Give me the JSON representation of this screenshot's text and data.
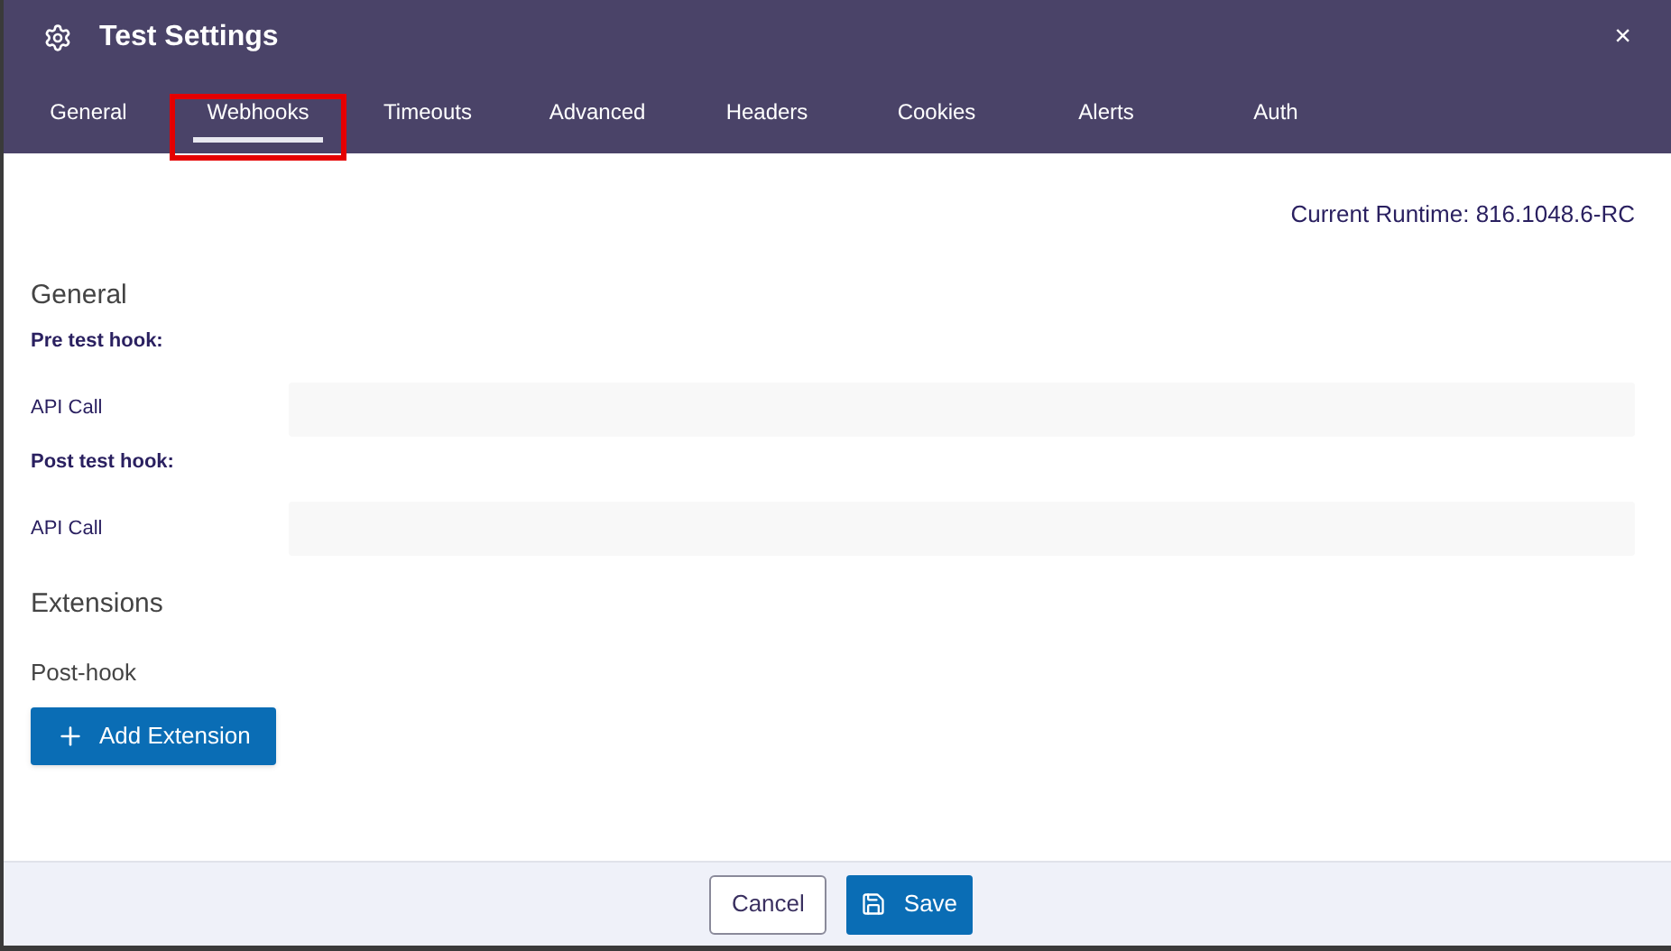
{
  "window": {
    "title": "Test Settings",
    "close": "×"
  },
  "tabs": [
    {
      "label": "General",
      "selected": false,
      "highlighted": false
    },
    {
      "label": "Webhooks",
      "selected": true,
      "highlighted": true
    },
    {
      "label": "Timeouts",
      "selected": false,
      "highlighted": false
    },
    {
      "label": "Advanced",
      "selected": false,
      "highlighted": false
    },
    {
      "label": "Headers",
      "selected": false,
      "highlighted": false
    },
    {
      "label": "Cookies",
      "selected": false,
      "highlighted": false
    },
    {
      "label": "Alerts",
      "selected": false,
      "highlighted": false
    },
    {
      "label": "Auth",
      "selected": false,
      "highlighted": false
    }
  ],
  "runtime": "Current Runtime: 816.1048.6-RC",
  "general": {
    "heading": "General",
    "hooks": [
      {
        "title": "Pre test hook:",
        "field_label": "API Call"
      },
      {
        "title": "Post test hook:",
        "field_label": "API Call"
      }
    ]
  },
  "extensions": {
    "heading": "Extensions",
    "subheading": "Post-hook",
    "button": "Add Extension"
  },
  "footer": {
    "cancel": "Cancel",
    "save": "Save"
  }
}
